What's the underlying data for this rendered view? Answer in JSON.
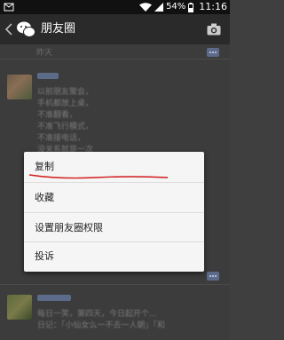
{
  "status_bar": {
    "battery": "54%",
    "time": "11:16",
    "icons": [
      "notification-icon",
      "wifi-icon",
      "signal-icon",
      "battery-icon"
    ]
  },
  "header": {
    "title": "朋友圈",
    "icons": [
      "back-icon",
      "wechat-logo-icon",
      "camera-icon"
    ]
  },
  "feed": {
    "posts": [
      {
        "date": "昨天",
        "lines": [
          "以前朋友聚会，",
          "手机都放上桌，",
          "不准翻看，",
          "不准飞行模式，",
          "不准接电话，",
          "没关系就是一次"
        ]
      },
      {
        "lines": [
          "每日一笑，第四天，今日起开个...",
          "日记：「小仙女么一不去一人朝」「和"
        ]
      }
    ]
  },
  "context_menu": {
    "items": [
      "复制",
      "收藏",
      "设置朋友圈权限",
      "投诉"
    ]
  },
  "colors": {
    "accent_red": "#d01a1a",
    "comment_icon": "#5c6b8a"
  }
}
